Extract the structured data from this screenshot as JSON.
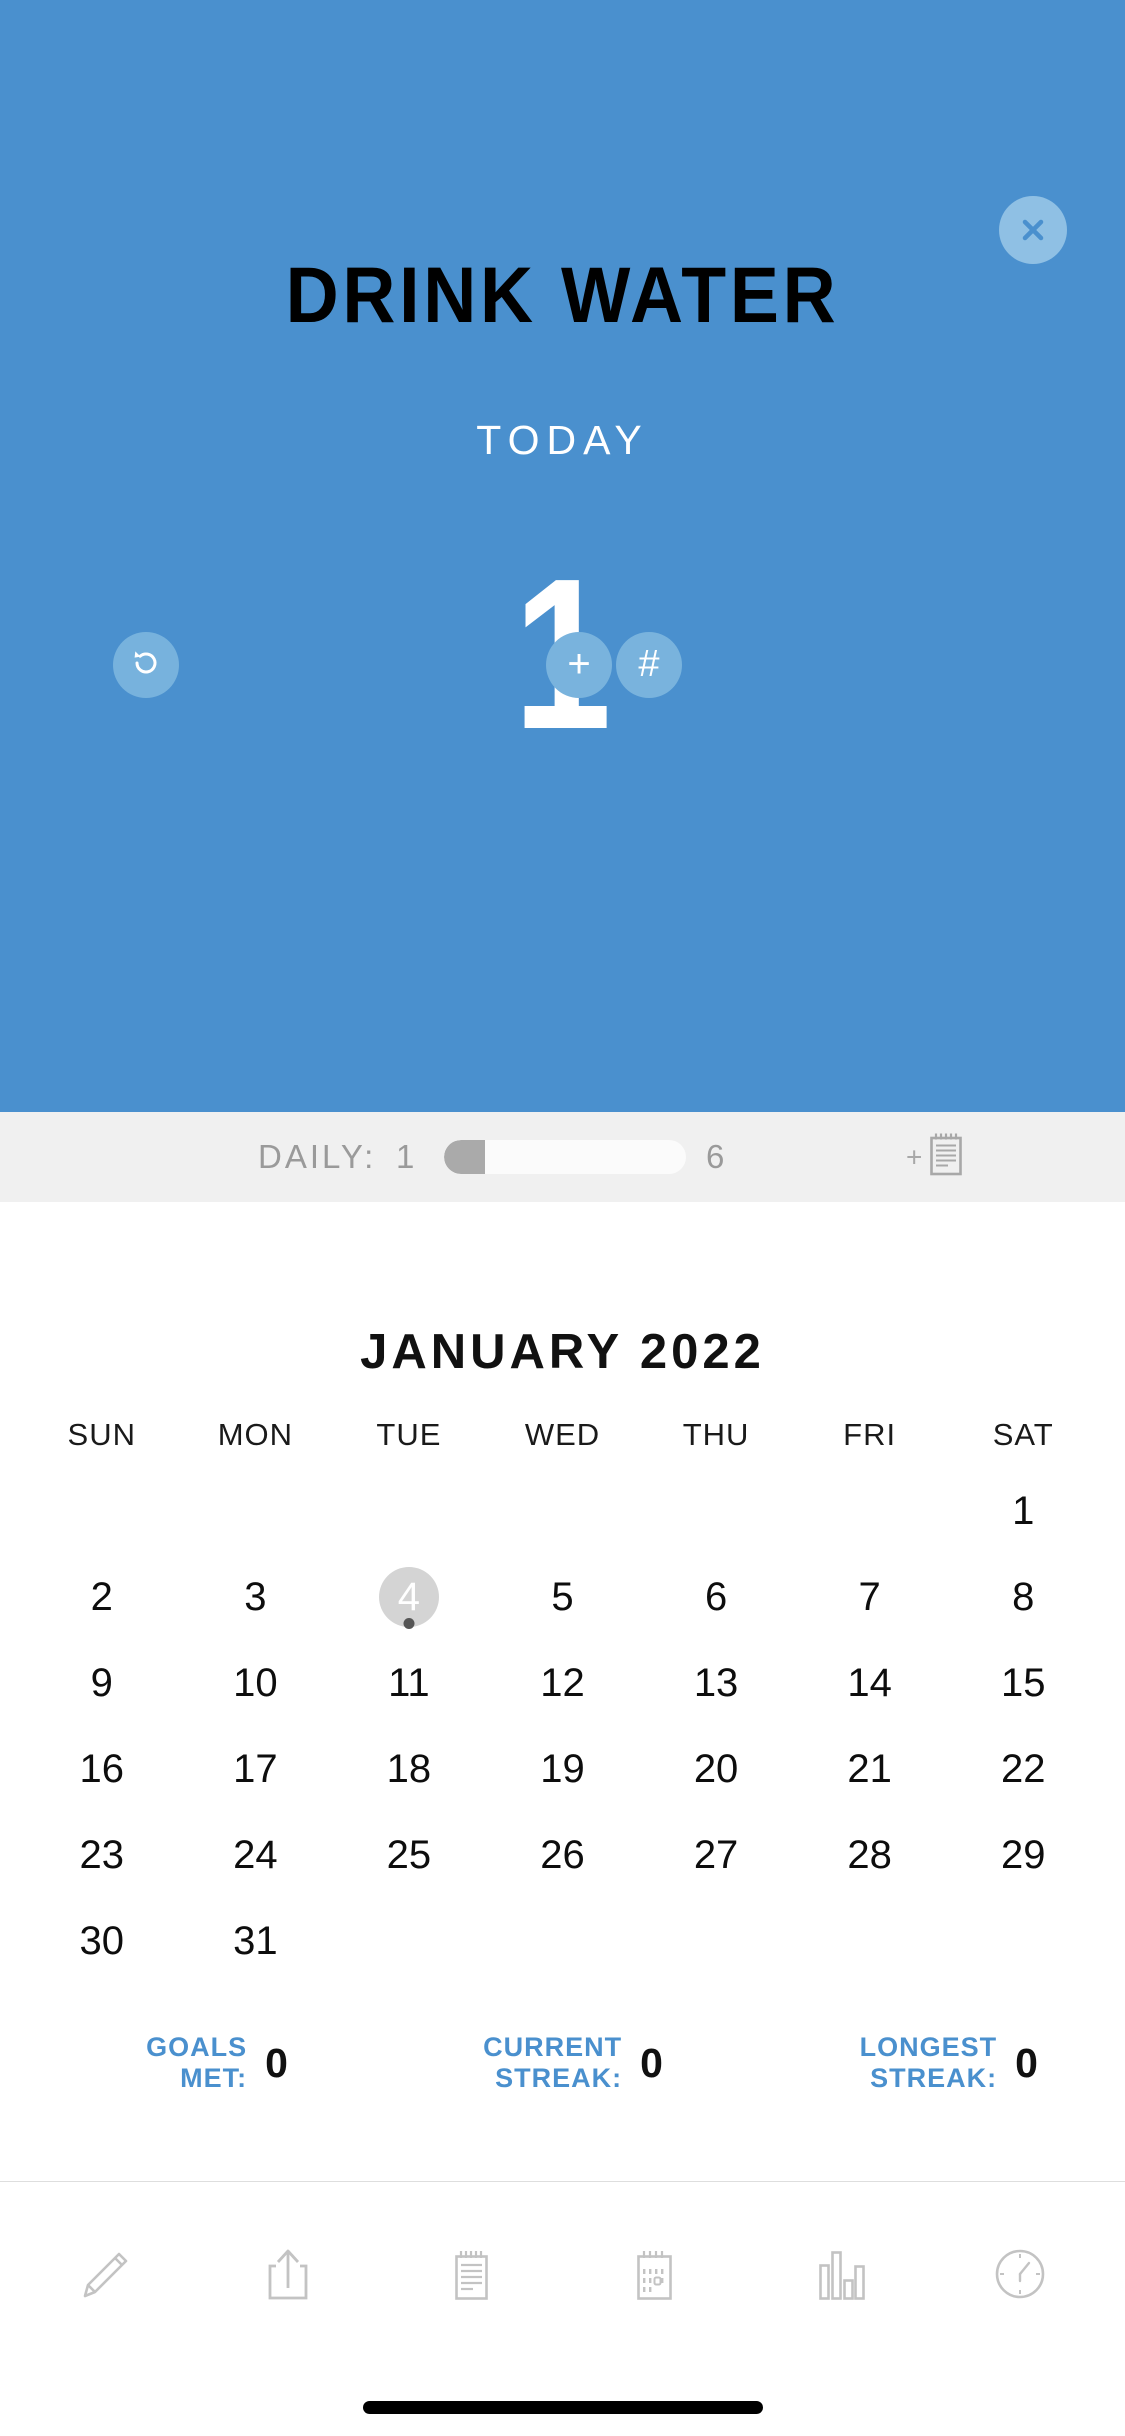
{
  "header": {
    "title": "DRINK WATER",
    "subtitle": "TODAY",
    "count": "1",
    "close_icon": "close-icon",
    "undo_icon": "undo-icon",
    "plus_label": "+",
    "hash_label": "#",
    "background_color": "#4a90ce",
    "button_color": "#79b3dd"
  },
  "daily": {
    "label": "DAILY:",
    "current": "1",
    "goal": "6",
    "progress_percent": 17,
    "add_note_plus": "+",
    "add_note_icon": "notepad-icon",
    "band_color": "#f0f0f0",
    "fill_color": "#aaaaaa"
  },
  "calendar": {
    "title": "JANUARY 2022",
    "weekdays": [
      "SUN",
      "MON",
      "TUE",
      "WED",
      "THU",
      "FRI",
      "SAT"
    ],
    "leading_blanks": 6,
    "days": [
      "1",
      "2",
      "3",
      "4",
      "5",
      "6",
      "7",
      "8",
      "9",
      "10",
      "11",
      "12",
      "13",
      "14",
      "15",
      "16",
      "17",
      "18",
      "19",
      "20",
      "21",
      "22",
      "23",
      "24",
      "25",
      "26",
      "27",
      "28",
      "29",
      "30",
      "31"
    ],
    "today": "4",
    "today_has_dot": true,
    "today_highlight_color": "#d4d4d4"
  },
  "stats": {
    "accent_color": "#4a90ce",
    "items": [
      {
        "label": "GOALS MET:",
        "value": "0"
      },
      {
        "label": "CURRENT STREAK:",
        "value": "0"
      },
      {
        "label": "LONGEST STREAK:",
        "value": "0"
      }
    ]
  },
  "toolbar": {
    "items": [
      {
        "icon": "pencil-icon",
        "name": "toolbar-edit"
      },
      {
        "icon": "share-icon",
        "name": "toolbar-share"
      },
      {
        "icon": "notepad-icon",
        "name": "toolbar-notes"
      },
      {
        "icon": "calendar-icon",
        "name": "toolbar-calendar"
      },
      {
        "icon": "bar-chart-icon",
        "name": "toolbar-stats"
      },
      {
        "icon": "clock-icon",
        "name": "toolbar-history"
      }
    ]
  }
}
